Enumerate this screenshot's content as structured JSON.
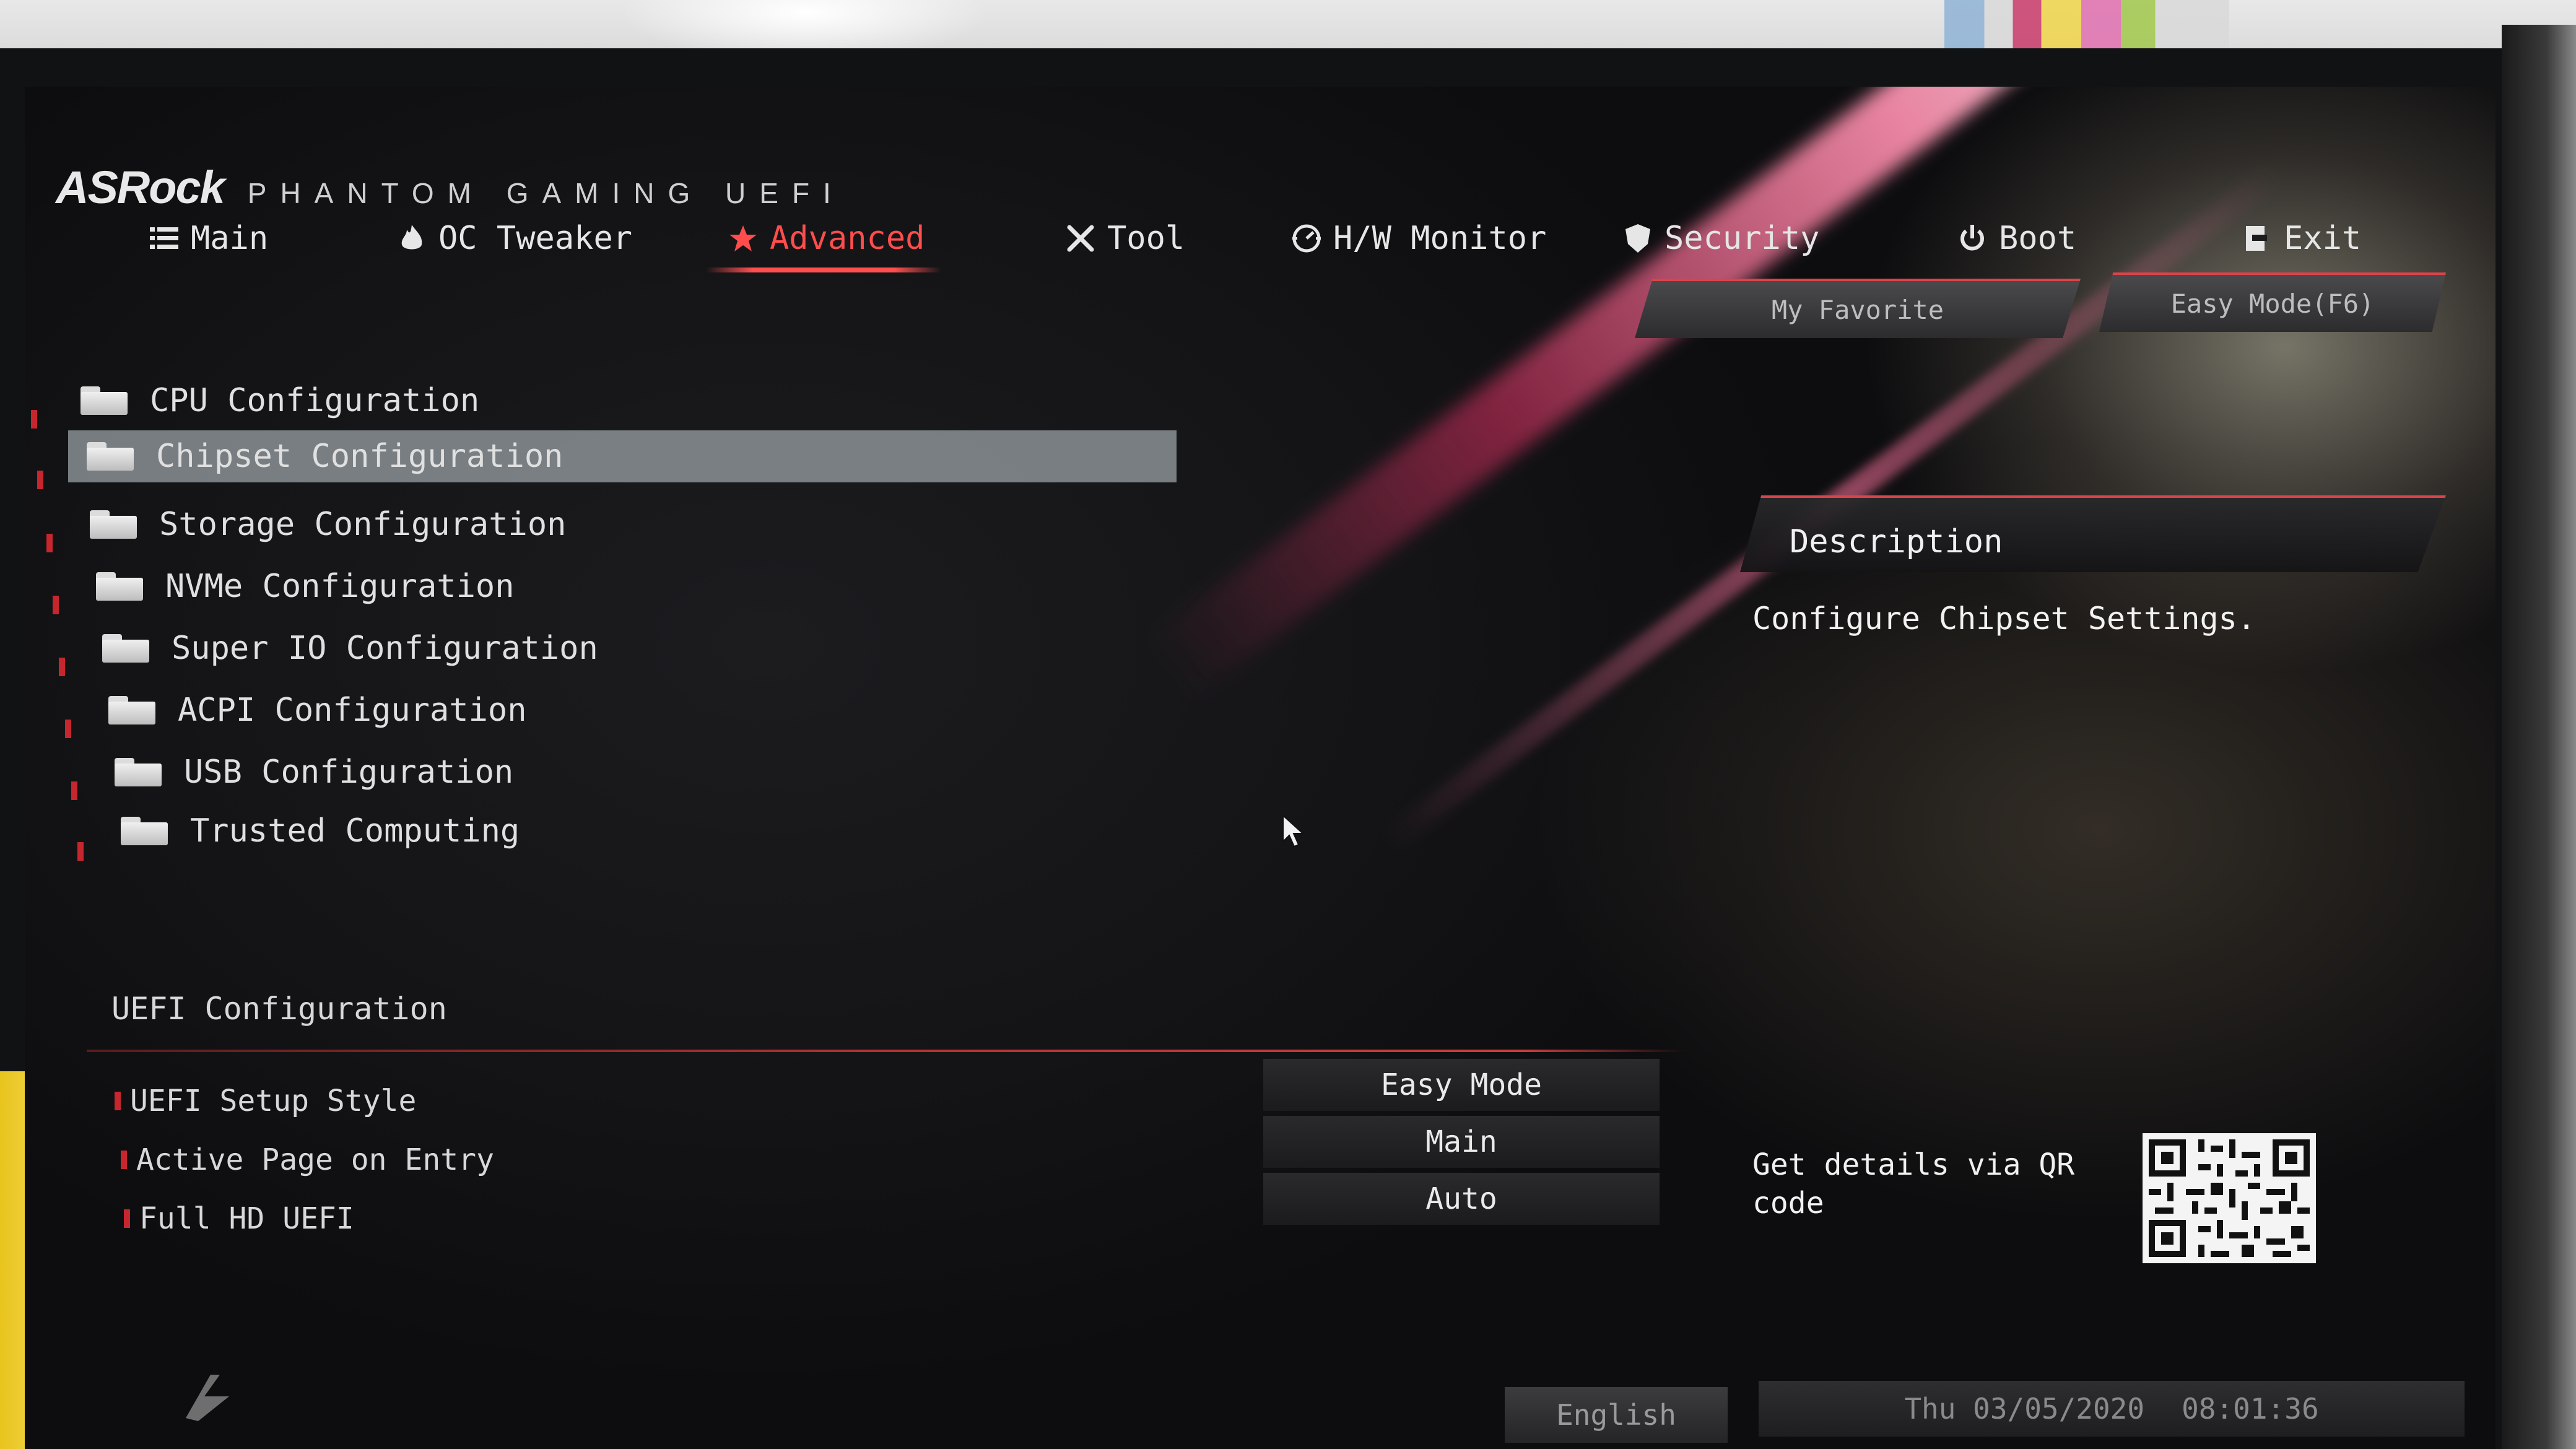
{
  "brand": {
    "logo": "ASRock",
    "subtitle": "PHANTOM GAMING UEFI"
  },
  "tabs": [
    {
      "label": "Main",
      "icon": "list-icon"
    },
    {
      "label": "OC Tweaker",
      "icon": "flame-icon"
    },
    {
      "label": "Advanced",
      "icon": "star-icon",
      "active": true
    },
    {
      "label": "Tool",
      "icon": "tools-icon"
    },
    {
      "label": "H/W Monitor",
      "icon": "monitor-gauge-icon"
    },
    {
      "label": "Security",
      "icon": "shield-icon"
    },
    {
      "label": "Boot",
      "icon": "power-icon"
    },
    {
      "label": "Exit",
      "icon": "exit-icon"
    }
  ],
  "header_buttons": {
    "favorite": "My Favorite",
    "easy_mode": "Easy Mode(F6)"
  },
  "menu_items": [
    "CPU Configuration",
    "Chipset Configuration",
    "Storage Configuration",
    "NVMe Configuration",
    "Super IO Configuration",
    "ACPI Configuration",
    "USB Configuration",
    "Trusted Computing"
  ],
  "selected_menu_item": "Chipset Configuration",
  "uefi_section": {
    "title": "UEFI Configuration",
    "settings": [
      {
        "label": "UEFI Setup Style",
        "value": "Easy Mode"
      },
      {
        "label": "Active Page on Entry",
        "value": "Main"
      },
      {
        "label": "Full HD UEFI",
        "value": "Auto"
      }
    ]
  },
  "description": {
    "title": "Description",
    "text": "Configure Chipset Settings."
  },
  "qr": {
    "text": "Get details via QR code"
  },
  "footer": {
    "language": "English",
    "date": "Thu 03/05/2020",
    "time": "08:01:36"
  },
  "colors": {
    "accent": "#ff4d4d",
    "bullet": "#c6262e",
    "selection": "#b4bec3"
  }
}
